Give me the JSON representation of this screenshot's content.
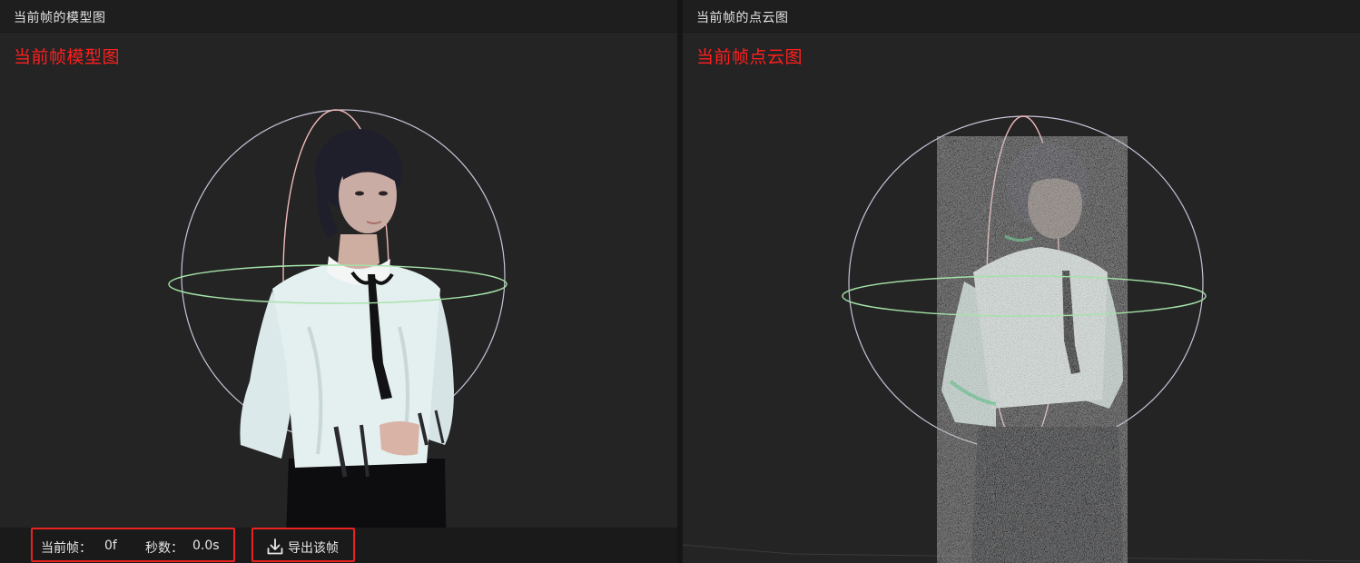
{
  "left_panel": {
    "header_title": "当前帧的模型图",
    "overlay_label": "当前帧模型图"
  },
  "right_panel": {
    "header_title": "当前帧的点云图",
    "overlay_label": "当前帧点云图"
  },
  "status": {
    "frame_label": "当前帧：",
    "frame_value": "0f",
    "seconds_label": "秒数：",
    "seconds_value": "0.0s"
  },
  "actions": {
    "export_label": "导出该帧",
    "export_icon": "download-icon"
  },
  "colors": {
    "overlay_text": "#ff1f1f",
    "highlight_border": "#e8221e",
    "ring_horizontal": "#a5e3a8",
    "ring_vertical": "#f0b8b8",
    "sphere_outline": "#c7c3d8"
  }
}
